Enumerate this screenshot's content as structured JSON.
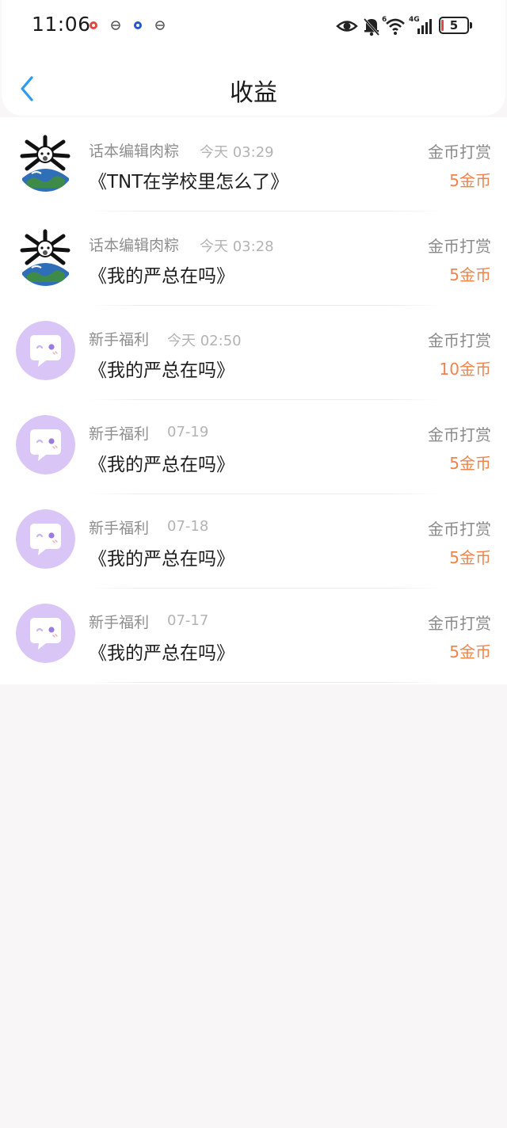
{
  "status_bar": {
    "time": "11:06",
    "battery": "5",
    "network": "4G",
    "wifi_badge": "6",
    "notification_icons": [
      "app-notification-icon-red",
      "app-notification-icon-gray",
      "app-notification-icon-blue",
      "app-notification-icon-gray"
    ],
    "status_icons": [
      "eye-icon",
      "bell-muted-icon",
      "wifi-icon",
      "signal-icon",
      "battery-icon"
    ]
  },
  "header": {
    "title": "收益",
    "back_icon": "chevron-left-icon"
  },
  "colors": {
    "accent_back": "#2d9bf0",
    "amount": "#f0834a",
    "background": "#f8f6f7",
    "avatar_purple": "#d9c6f7"
  },
  "earnings": [
    {
      "source": "话本编辑肉粽",
      "time": "今天 03:29",
      "work": "《TNT在学校里怎么了》",
      "type": "金币打赏",
      "amount": "5金币",
      "avatar": "editor-avatar"
    },
    {
      "source": "话本编辑肉粽",
      "time": "今天 03:28",
      "work": "《我的严总在吗》",
      "type": "金币打赏",
      "amount": "5金币",
      "avatar": "editor-avatar"
    },
    {
      "source": "新手福利",
      "time": "今天 02:50",
      "work": "《我的严总在吗》",
      "type": "金币打赏",
      "amount": "10金币",
      "avatar": "chat-bubble-avatar"
    },
    {
      "source": "新手福利",
      "time": "07-19",
      "work": "《我的严总在吗》",
      "type": "金币打赏",
      "amount": "5金币",
      "avatar": "chat-bubble-avatar"
    },
    {
      "source": "新手福利",
      "time": "07-18",
      "work": "《我的严总在吗》",
      "type": "金币打赏",
      "amount": "5金币",
      "avatar": "chat-bubble-avatar"
    },
    {
      "source": "新手福利",
      "time": "07-17",
      "work": "《我的严总在吗》",
      "type": "金币打赏",
      "amount": "5金币",
      "avatar": "chat-bubble-avatar"
    }
  ]
}
